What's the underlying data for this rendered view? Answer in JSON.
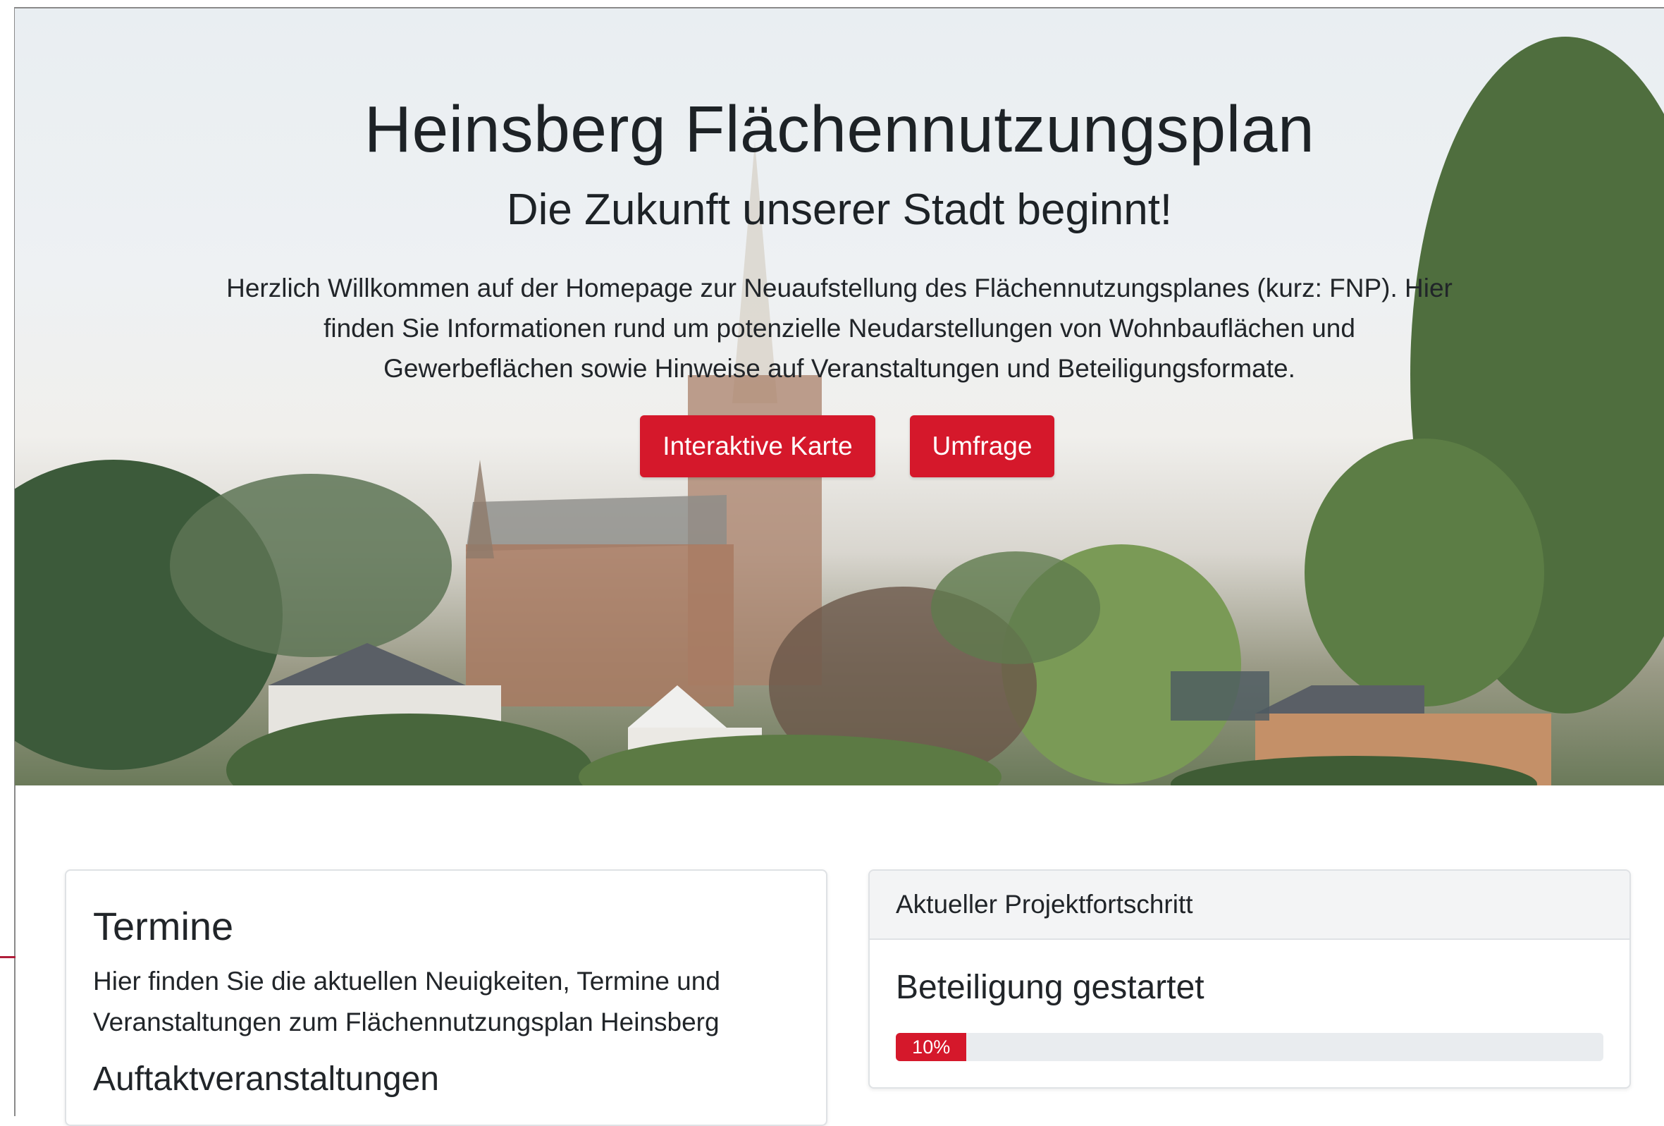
{
  "hero": {
    "title": "Heinsberg Flächennutzungsplan",
    "subtitle": "Die Zukunft unserer Stadt beginnt!",
    "intro": "Herzlich Willkommen auf der Homepage zur Neuaufstellung des Flächennutzungsplanes (kurz: FNP). Hier finden Sie Informationen rund um potenzielle Neudarstellungen von Wohnbauflächen und Gewerbeflächen sowie Hinweise auf Veranstaltungen und Beteiligungsformate.",
    "buttons": {
      "map_label": "Interaktive Karte",
      "survey_label": "Umfrage"
    }
  },
  "termine": {
    "title": "Termine",
    "text": "Hier finden Sie die aktuellen Neuigkeiten, Termine und Veranstaltungen zum Flächennutzungsplan Heinsberg",
    "subheading": "Auftaktveranstaltungen"
  },
  "progress": {
    "header": "Aktueller Projektfortschritt",
    "status": "Beteiligung gestartet",
    "value": 0.1,
    "label": "10%"
  },
  "colors": {
    "accent_red": "#d5182b",
    "card_border": "#dfe2e5",
    "progress_track": "#e9ecef"
  }
}
